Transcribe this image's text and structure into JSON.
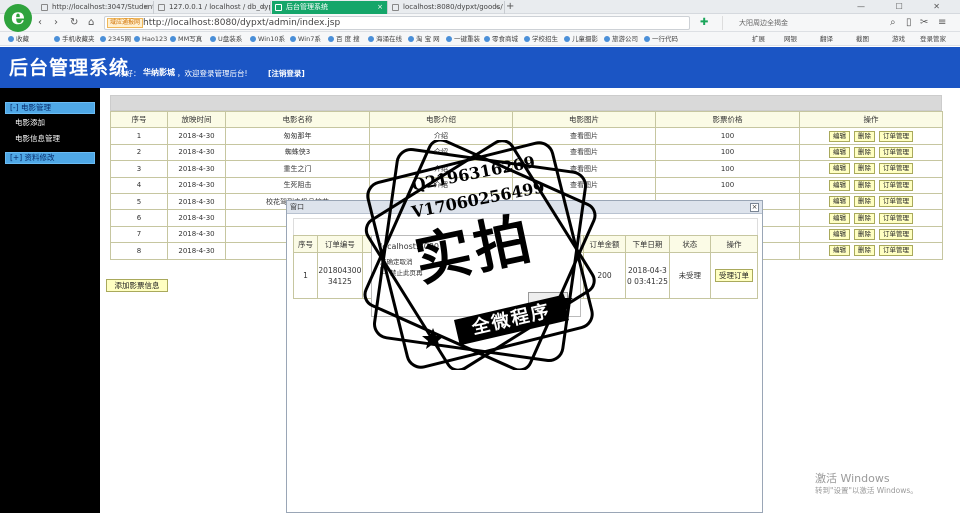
{
  "browser": {
    "tabs": [
      {
        "label": "http://localhost:3047/StudentX",
        "active": false
      },
      {
        "label": "127.0.0.1 / localhost / db_dypx",
        "active": false
      },
      {
        "label": "后台管理系统",
        "active": true
      },
      {
        "label": "localhost:8080/dypxt/goods/",
        "active": false
      }
    ],
    "new_tab": "+",
    "window_controls": "— ☐ ✕",
    "address": {
      "badge": "域应通报网",
      "url": "http://localhost:8080/dypxt/admin/index.jsp"
    },
    "search_placeholder": "大阳周边全揭金",
    "bookmarks": [
      "收藏",
      "手机收藏夹",
      "2345网",
      "Hao123",
      "MM写真",
      "U盘装系",
      "Win10系",
      "Win7系",
      "百 度 搜",
      "海涌在线",
      "淘 宝 网",
      "一键重装",
      "零食商城",
      "学校招生",
      "儿童摄影",
      "旅游公司",
      "一行代码"
    ],
    "bookmarks_right": [
      "扩展",
      "网银",
      "翻译",
      "截图",
      "游戏",
      "登录管家"
    ]
  },
  "header": {
    "title": "后台管理系统",
    "greet_prefix": "你好：",
    "user": "华纳影城",
    "greet_suffix": "，欢迎登录管理后台!",
    "logout": "[注销登录]"
  },
  "sidebar": {
    "groups": [
      {
        "label": "[-] 电影管理",
        "items": [
          "电影添加",
          "电影信息管理"
        ]
      },
      {
        "label": "[+] 资料修改",
        "items": []
      }
    ]
  },
  "movie_table": {
    "columns": [
      "序号",
      "放映时间",
      "电影名称",
      "电影介绍",
      "电影图片",
      "影票价格",
      "操作"
    ],
    "rows": [
      {
        "id": "1",
        "time": "2018-4-30",
        "name": "匆匆那年",
        "intro": "介绍",
        "img": "查看图片",
        "price": "100"
      },
      {
        "id": "2",
        "time": "2018-4-30",
        "name": "蜘蛛侠3",
        "intro": "介绍",
        "img": "查看图片",
        "price": "100"
      },
      {
        "id": "3",
        "time": "2018-4-30",
        "name": "重生之门",
        "intro": "介绍",
        "img": "查看图片",
        "price": "100"
      },
      {
        "id": "4",
        "time": "2018-4-30",
        "name": "生死阻击",
        "intro": "介绍",
        "img": "查看图片",
        "price": "100"
      },
      {
        "id": "5",
        "time": "2018-4-30",
        "name": "校花驾到之极品校花",
        "intro": "",
        "img": "",
        "price": ""
      },
      {
        "id": "6",
        "time": "2018-4-30",
        "name": "",
        "intro": "",
        "img": "",
        "price": ""
      },
      {
        "id": "7",
        "time": "2018-4-30",
        "name": "我的",
        "intro": "",
        "img": "",
        "price": ""
      },
      {
        "id": "8",
        "time": "2018-4-30",
        "name": "心",
        "intro": "",
        "img": "",
        "price": ""
      }
    ],
    "actions": [
      "编辑",
      "删除",
      "订单管理"
    ]
  },
  "add_button": "添加影票信息",
  "dialog": {
    "title": "窗口",
    "close": "×",
    "columns": [
      "序号",
      "订单编号",
      "放映时",
      "",
      "",
      "电话",
      "订单金额",
      "下单日期",
      "状态",
      "操作"
    ],
    "row": {
      "id": "1",
      "order_no": "20180430034125",
      "time": "2018-",
      "phone": "7154",
      "amount": "200",
      "date": "2018-04-30 03:41:25",
      "status": "未受理",
      "action": "受理订单"
    }
  },
  "confirm": {
    "url": "localhost:8080",
    "msg": "您确定取消",
    "check": "禁止此页再"
  },
  "watermark": {
    "line1": "Q2196316269",
    "line2": "V17060256499",
    "big": "实拍",
    "banner": "全微程序"
  },
  "os": {
    "activate_title": "激活 Windows",
    "activate_sub": "转到\"设置\"以激活 Windows。"
  },
  "colors": {
    "header": "#1b55c4",
    "sidebar": "#000000",
    "menu_head": "#4fa8e6",
    "active_tab": "#15a66a",
    "button_bg": "#ffffc2"
  }
}
